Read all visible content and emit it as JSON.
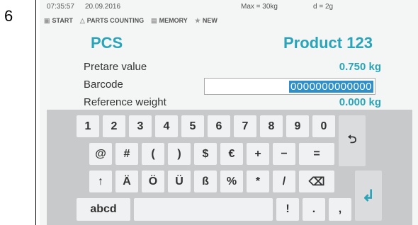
{
  "step_number": "6",
  "status": {
    "time": "07:35:57",
    "date": "20.09.2016",
    "max": "Max = 30kg",
    "d": "d = 2g"
  },
  "menu": [
    {
      "label": "START",
      "icon": "start-icon"
    },
    {
      "label": "PARTS COUNTING",
      "icon": "parts-counting-icon"
    },
    {
      "label": "MEMORY",
      "icon": "memory-icon"
    },
    {
      "label": "NEW",
      "icon": "star-icon"
    }
  ],
  "header": {
    "mode": "PCS",
    "product": "Product 123"
  },
  "fields": {
    "pretare_label": "Pretare value",
    "pretare_value": "0.750 kg",
    "barcode_label": "Barcode",
    "barcode_value": "0000000000000",
    "refweight_label": "Reference weight",
    "refweight_value": "0.000 kg"
  },
  "keyboard": {
    "row1": [
      "1",
      "2",
      "3",
      "4",
      "5",
      "6",
      "7",
      "8",
      "9",
      "0"
    ],
    "row2": [
      "@",
      "#",
      "(",
      ")",
      "$",
      "€",
      "+",
      "−",
      "="
    ],
    "row3": [
      "↑",
      "Ä",
      "Ö",
      "Ü",
      "ß",
      "%",
      "*",
      "/"
    ],
    "backspace": "⌫",
    "back": "⮌",
    "mode_key": "abcd",
    "row4": [
      "!",
      ".",
      ","
    ],
    "enter": "↲"
  },
  "colors": {
    "accent": "#2aa4b8",
    "selection": "#2f8fc8",
    "keyboard_bg": "#c7c9cb"
  }
}
